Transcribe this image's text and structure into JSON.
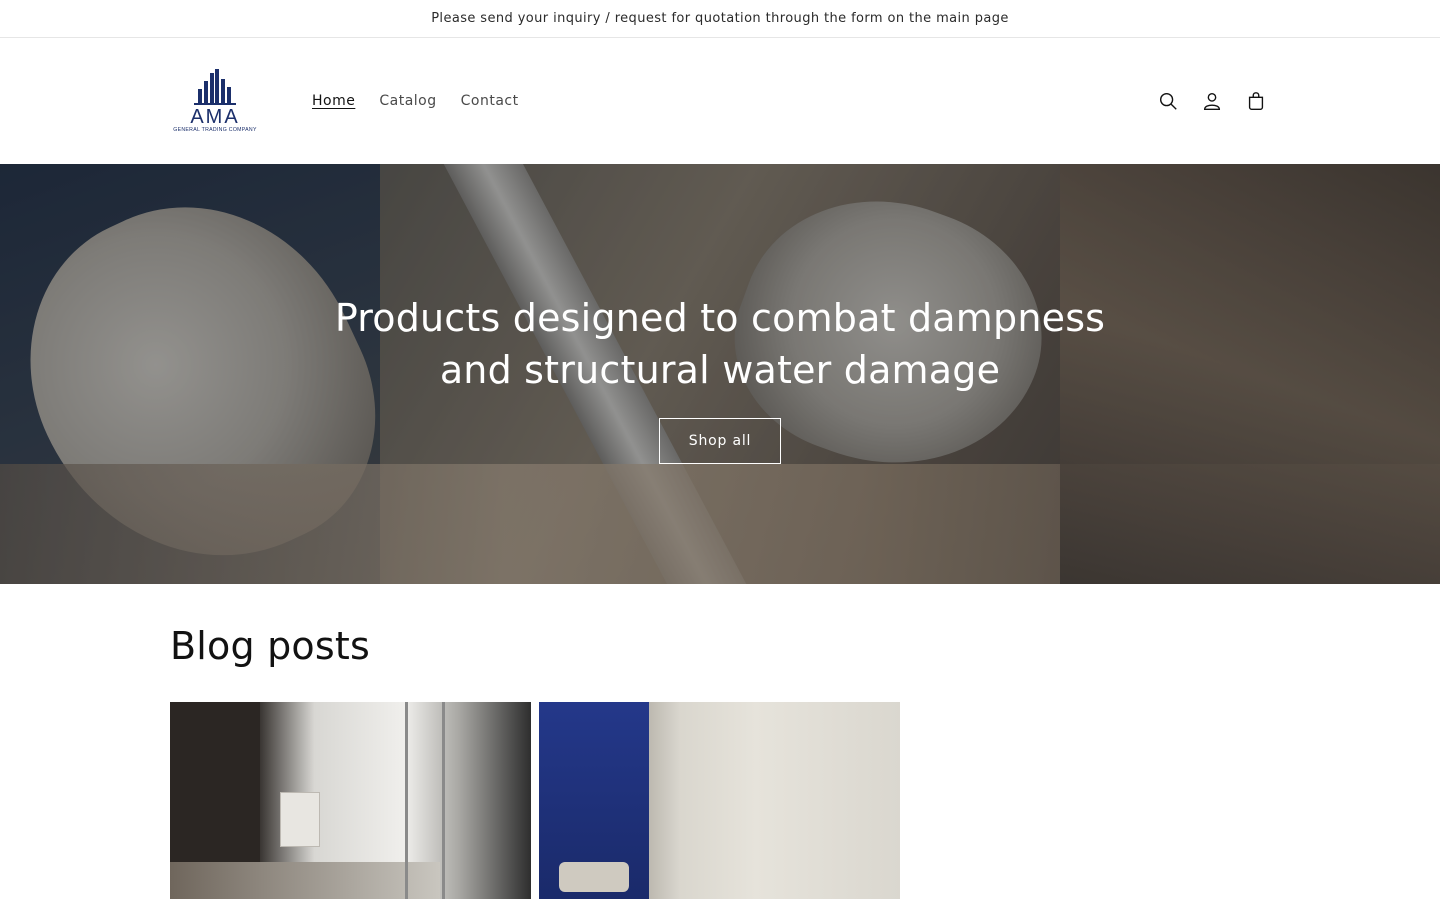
{
  "announcement": {
    "text": "Please send your inquiry / request for quotation through the form on the main page"
  },
  "logo": {
    "name": "AMA",
    "tagline": "GENERAL TRADING COMPANY"
  },
  "nav": {
    "items": [
      {
        "label": "Home"
      },
      {
        "label": "Catalog"
      },
      {
        "label": "Contact"
      }
    ]
  },
  "header_icons": {
    "search": "search-icon",
    "account": "account-icon",
    "cart": "cart-icon"
  },
  "hero": {
    "title": "Products designed to combat dampness and structural water damage",
    "button": "Shop all"
  },
  "blog": {
    "heading": "Blog posts",
    "posts": [
      {
        "image": "blog-post-image-1"
      },
      {
        "image": "blog-post-image-2"
      }
    ]
  },
  "colors": {
    "brand": "#1b2f6b",
    "text": "#121212",
    "border": "#e6e6e6"
  }
}
